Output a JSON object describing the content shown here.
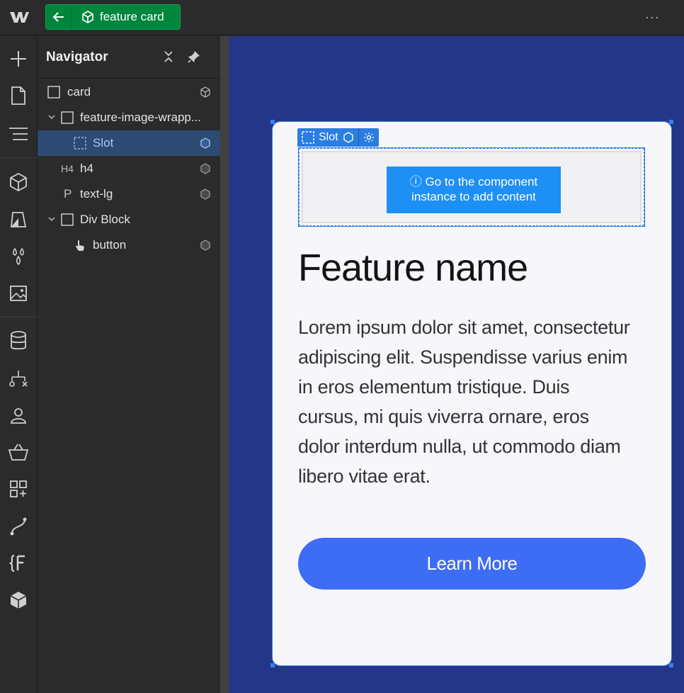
{
  "topbar": {
    "component_name": "feature card",
    "more_label": "···"
  },
  "navigator": {
    "title": "Navigator",
    "items": [
      {
        "label": "card",
        "type": "div"
      },
      {
        "label": "feature-image-wrapp...",
        "type": "div"
      },
      {
        "label": "Slot",
        "type": "slot",
        "selected": true
      },
      {
        "label": "h4",
        "type": "heading",
        "tag_label": "H4"
      },
      {
        "label": "text-lg",
        "type": "paragraph",
        "tag_label": "P"
      },
      {
        "label": "Div Block",
        "type": "div"
      },
      {
        "label": "button",
        "type": "button"
      }
    ]
  },
  "canvas": {
    "slot_badge_label": "Slot",
    "slot_message": "ⓘ Go to the component instance to add content",
    "feature_title": "Feature name",
    "feature_body": "Lorem ipsum dolor sit amet, consectetur adipiscing elit. Suspendisse varius enim in eros elementum tristique. Duis cursus, mi quis viverra ornare, eros dolor interdum nulla, ut commodo diam libero vitae erat.",
    "button_label": "Learn More"
  },
  "colors": {
    "component_green": "#00853d",
    "selection_blue": "#2a7de1",
    "canvas_bg": "#233687",
    "button_blue": "#3d6cf5"
  }
}
